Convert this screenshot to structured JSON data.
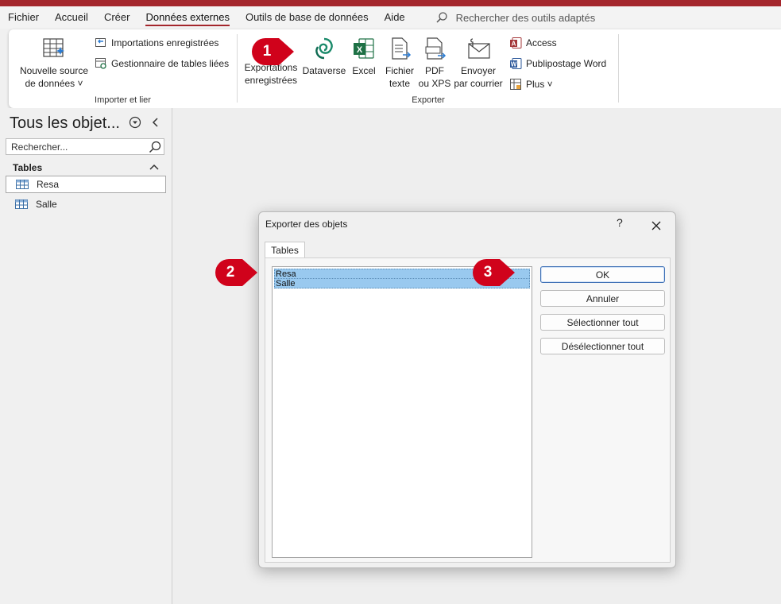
{
  "menubar": {
    "tabs": [
      "Fichier",
      "Accueil",
      "Créer",
      "Données externes",
      "Outils de base de données",
      "Aide"
    ],
    "active_tab": "Données externes",
    "search_placeholder": "Rechercher des outils adaptés"
  },
  "ribbon": {
    "import_group": {
      "label": "Importer et lier",
      "new_source_line1": "Nouvelle source",
      "new_source_line2": "de données",
      "saved_imports": "Importations enregistrées",
      "linked_table_manager": "Gestionnaire de tables liées"
    },
    "export_group": {
      "label": "Exporter",
      "saved_exports_line1": "Exportations",
      "saved_exports_line2": "enregistrées",
      "dataverse": "Dataverse",
      "excel": "Excel",
      "text_file_line1": "Fichier",
      "text_file_line2": "texte",
      "pdf_line1": "PDF",
      "pdf_line2": "ou XPS",
      "email_line1": "Envoyer",
      "email_line2": "par courrier",
      "access": "Access",
      "word_merge": "Publipostage Word",
      "more": "Plus"
    }
  },
  "callouts": [
    "1",
    "2",
    "3"
  ],
  "nav_pane": {
    "title": "Tous les objet...",
    "search_placeholder": "Rechercher...",
    "section": "Tables",
    "items": [
      "Resa",
      "Salle"
    ],
    "selected_item": "Resa"
  },
  "dialog": {
    "title": "Exporter des objets",
    "help": "?",
    "tab": "Tables",
    "list_items": [
      "Resa",
      "Salle"
    ],
    "buttons": {
      "ok": "OK",
      "cancel": "Annuler",
      "select_all": "Sélectionner tout",
      "deselect_all": "Désélectionner tout"
    }
  },
  "colors": {
    "accent": "#a4262c",
    "callout": "#d0021b",
    "selection": "#99c9ef",
    "excel": "#1e7145",
    "access": "#a4373a",
    "word": "#2b579a"
  }
}
